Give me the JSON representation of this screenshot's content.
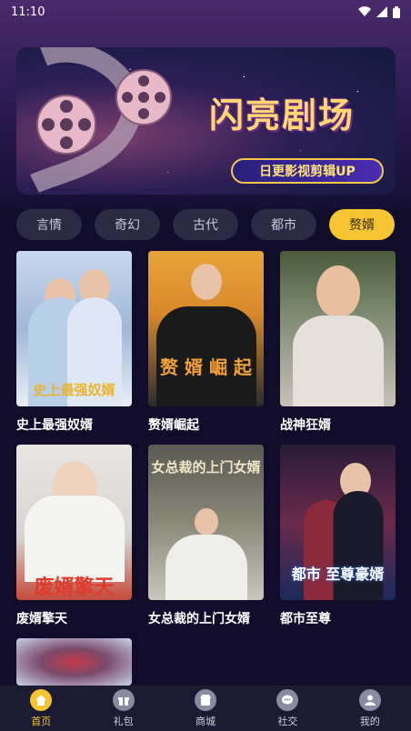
{
  "status_bar": {
    "time": "11:10"
  },
  "banner": {
    "title": "闪亮剧场",
    "subtitle": "日更影视剪辑UP"
  },
  "filters": [
    {
      "label": "言情",
      "active": false
    },
    {
      "label": "奇幻",
      "active": false
    },
    {
      "label": "古代",
      "active": false
    },
    {
      "label": "都市",
      "active": false
    },
    {
      "label": "赘婿",
      "active": true
    }
  ],
  "shows": [
    {
      "title": "史上最强奴婿",
      "poster_text": "史上最强奴婿"
    },
    {
      "title": "赘婿崛起",
      "poster_text": "赘 婿 崛 起"
    },
    {
      "title": "战神狂婿",
      "poster_text": ""
    },
    {
      "title": "废婿擎天",
      "poster_text": "废婿擎天"
    },
    {
      "title": "女总裁的上门女婿",
      "poster_text": "女总裁的上门女婿"
    },
    {
      "title": "都市至尊",
      "poster_text": "都市 至尊豪婿"
    },
    {
      "title": "",
      "poster_text": ""
    }
  ],
  "bottom_nav": [
    {
      "label": "首页",
      "icon": "home-icon",
      "active": true
    },
    {
      "label": "礼包",
      "icon": "gift-icon",
      "active": false
    },
    {
      "label": "商城",
      "icon": "shop-icon",
      "active": false
    },
    {
      "label": "社交",
      "icon": "chat-icon",
      "active": false
    },
    {
      "label": "我的",
      "icon": "profile-icon",
      "active": false
    }
  ],
  "colors": {
    "accent": "#f5c531",
    "background": "#100c2a",
    "chip": "#2b2a45"
  }
}
